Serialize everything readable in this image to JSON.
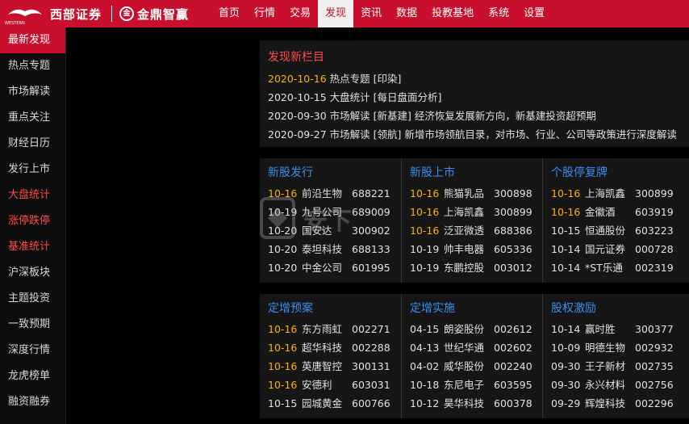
{
  "logo": {
    "brand1": "西部证券",
    "sub": "WESTERN",
    "circle": "金",
    "brand2": "金鼎智赢"
  },
  "nav": [
    "首页",
    "行情",
    "交易",
    "发现",
    "资讯",
    "数据",
    "投教基地",
    "系统",
    "设置"
  ],
  "nav_active": "发现",
  "sidebar": [
    {
      "label": "最新发现",
      "style": "active"
    },
    {
      "label": "热点专题",
      "style": "normal"
    },
    {
      "label": "市场解读",
      "style": "normal"
    },
    {
      "label": "重点关注",
      "style": "normal"
    },
    {
      "label": "财经日历",
      "style": "normal"
    },
    {
      "label": "发行上市",
      "style": "normal"
    },
    {
      "label": "大盘统计",
      "style": "red"
    },
    {
      "label": "涨停跌停",
      "style": "red"
    },
    {
      "label": "基准统计",
      "style": "red"
    },
    {
      "label": "沪深板块",
      "style": "normal"
    },
    {
      "label": "主题投资",
      "style": "normal"
    },
    {
      "label": "一致预期",
      "style": "normal"
    },
    {
      "label": "深度行情",
      "style": "normal"
    },
    {
      "label": "龙虎榜单",
      "style": "normal"
    },
    {
      "label": "融资融券",
      "style": "normal"
    }
  ],
  "discover": {
    "title": "发现新栏目",
    "rows": [
      {
        "date": "2020-10-16",
        "text": " 热点专题 [印染]",
        "highlight": true
      },
      {
        "date": "2020-10-15",
        "text": " 大盘统计 [每日盘面分析]",
        "highlight": false
      },
      {
        "date": "2020-09-30",
        "text": " 市场解读 [新基建]  经济恢复发展新方向，新基建投资超预期",
        "highlight": false
      },
      {
        "date": "2020-09-27",
        "text": " 市场解读 [领航]  新增市场领航目录，对市场、行业、公司等政策进行深度解读",
        "highlight": false
      }
    ]
  },
  "grid_top": [
    {
      "title": "新股发行",
      "entries": [
        {
          "d": "10-16",
          "n": "前沿生物",
          "c": "688221",
          "hl": true
        },
        {
          "d": "10-19",
          "n": "九号公司",
          "c": "689009",
          "hl": false
        },
        {
          "d": "10-20",
          "n": "国安达",
          "c": "300902",
          "hl": false
        },
        {
          "d": "10-20",
          "n": "泰坦科技",
          "c": "688133",
          "hl": false
        },
        {
          "d": "10-20",
          "n": "中金公司",
          "c": "601995",
          "hl": false
        }
      ]
    },
    {
      "title": "新股上市",
      "entries": [
        {
          "d": "10-16",
          "n": "熊猫乳品",
          "c": "300898",
          "hl": true
        },
        {
          "d": "10-16",
          "n": "上海凯鑫",
          "c": "300899",
          "hl": true
        },
        {
          "d": "10-16",
          "n": "泛亚微透",
          "c": "688386",
          "hl": true
        },
        {
          "d": "10-19",
          "n": "帅丰电器",
          "c": "605336",
          "hl": false
        },
        {
          "d": "10-19",
          "n": "东鹏控股",
          "c": "003012",
          "hl": false
        }
      ]
    },
    {
      "title": "个股停复牌",
      "entries": [
        {
          "d": "10-16",
          "n": "上海凯鑫",
          "c": "300899",
          "hl": true
        },
        {
          "d": "10-16",
          "n": "金徽酒",
          "c": "603919",
          "hl": true
        },
        {
          "d": "10-15",
          "n": "恒通股份",
          "c": "603223",
          "hl": false
        },
        {
          "d": "10-14",
          "n": "国元证券",
          "c": "000728",
          "hl": false
        },
        {
          "d": "10-14",
          "n": "*ST乐通",
          "c": "002319",
          "hl": false
        }
      ]
    }
  ],
  "grid_bot": [
    {
      "title": "定增预案",
      "entries": [
        {
          "d": "10-16",
          "n": "东方雨虹",
          "c": "002271",
          "hl": true
        },
        {
          "d": "10-16",
          "n": "超华科技",
          "c": "002288",
          "hl": true
        },
        {
          "d": "10-16",
          "n": "英唐智控",
          "c": "300131",
          "hl": true
        },
        {
          "d": "10-16",
          "n": "安德利",
          "c": "603031",
          "hl": true
        },
        {
          "d": "10-15",
          "n": "园城黄金",
          "c": "600766",
          "hl": false
        }
      ]
    },
    {
      "title": "定增实施",
      "entries": [
        {
          "d": "04-15",
          "n": "朗姿股份",
          "c": "002612",
          "hl": false
        },
        {
          "d": "04-13",
          "n": "世纪华通",
          "c": "002602",
          "hl": false
        },
        {
          "d": "04-02",
          "n": "威华股份",
          "c": "002240",
          "hl": false
        },
        {
          "d": "10-18",
          "n": "东尼电子",
          "c": "603595",
          "hl": false
        },
        {
          "d": "10-12",
          "n": "昊华科技",
          "c": "600378",
          "hl": false
        }
      ]
    },
    {
      "title": "股权激励",
      "entries": [
        {
          "d": "10-14",
          "n": "赢时胜",
          "c": "300377",
          "hl": false
        },
        {
          "d": "10-09",
          "n": "明德生物",
          "c": "002932",
          "hl": false
        },
        {
          "d": "09-30",
          "n": "王子新材",
          "c": "002735",
          "hl": false
        },
        {
          "d": "09-30",
          "n": "永兴材料",
          "c": "002756",
          "hl": false
        },
        {
          "d": "09-29",
          "n": "辉煌科技",
          "c": "002296",
          "hl": false
        }
      ]
    }
  ]
}
